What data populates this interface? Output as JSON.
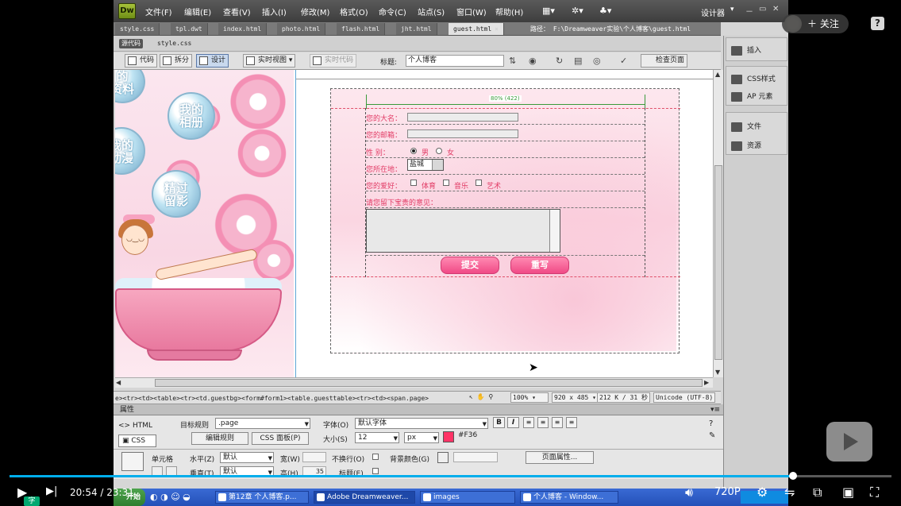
{
  "app": {
    "logo": "Dw",
    "menu": [
      "文件(F)",
      "编辑(E)",
      "查看(V)",
      "插入(I)",
      "修改(M)",
      "格式(O)",
      "命令(C)",
      "站点(S)",
      "窗口(W)",
      "帮助(H)"
    ],
    "designer_label": "设计器",
    "window_buttons": [
      "－",
      "▭",
      "✕"
    ]
  },
  "tabs": {
    "items": [
      "style.css",
      "tpl.dwt",
      "index.html",
      "photo.html",
      "flash.html",
      "jht.html",
      "guest.html"
    ],
    "active_index": 6,
    "path": "路径：  F:\\Dreamweaver实验\\个人博客\\guest.html"
  },
  "source_bar": {
    "source_label": "源代码",
    "file": "style.css"
  },
  "doc_toolbar": {
    "code": "代码",
    "split": "拆分",
    "design": "设计",
    "live_view": "实时视图",
    "live_code": "实时代码",
    "title_label": "标题:",
    "title_value": "个人博客",
    "check_page": "检查页面"
  },
  "left_art": {
    "bubble_1": "的\n资料",
    "bubble_2": "我的\n相册",
    "bubble_3": "我的\n动漫",
    "bubble_4": "精过\n留影"
  },
  "form": {
    "width_indicator": "80% (422)",
    "name_label": "您的大名：",
    "email_label": "您的邮箱：",
    "gender_label": "性    别：",
    "gender_male": "男",
    "gender_female": "女",
    "location_label": "您所在地：",
    "location_value": "盐城",
    "hobby_label": "您的爱好：",
    "hobbies": [
      "体育",
      "音乐",
      "艺术"
    ],
    "message_label": "请您留下宝贵的意见：",
    "submit": "提交",
    "reset": "重写"
  },
  "status_bar": {
    "tag_path": "e><tr><td><table><tr><td.guestbg><form#form1><table.guesttable><tr><td><span.page>",
    "zoom": "100%",
    "size": "920 x 485",
    "file_size": "212 K / 31 秒",
    "encoding": "Unicode (UTF-8)"
  },
  "properties": {
    "header": "属性",
    "html_tab": "HTML",
    "css_tab": "CSS",
    "target_rule_label": "目标规则",
    "target_rule_value": ".page",
    "edit_rule": "编辑规则",
    "css_panel": "CSS 面板(P)",
    "font_label": "字体(O)",
    "font_value": "默认字体",
    "size_label": "大小(S)",
    "size_value": "12",
    "size_unit": "px",
    "color_value": "#F36",
    "color_hex": "#FF3366",
    "cell_label": "单元格",
    "horz_label": "水平(Z)",
    "horz_value": "默认",
    "vert_label": "垂直(T)",
    "vert_value": "默认",
    "width_label": "宽(W)",
    "height_label": "高(H)",
    "height_value": "35",
    "nowrap_label": "不换行(O)",
    "header_label": "标题(E)",
    "bg_color_label": "背景颜色(G)",
    "page_props": "页面属性..."
  },
  "right_panel": {
    "insert": "插入",
    "css_styles": "CSS样式",
    "ap_elements": "AP 元素",
    "files": "文件",
    "assets": "资源"
  },
  "taskbar": {
    "start": "开始",
    "items": [
      "第12章 个人博客.p...",
      "Adobe Dreamweaver...",
      "images",
      "个人博客 - Window..."
    ]
  },
  "player": {
    "time_current": "20:54",
    "time_total": "23:31",
    "progress": 0.8886,
    "quality": "720P",
    "follow": "关注",
    "help": "?",
    "subtitle_badge": "字"
  }
}
